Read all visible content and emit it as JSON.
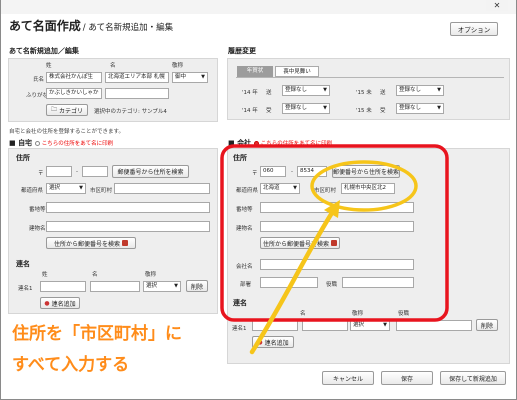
{
  "window": {
    "close_glyph": "✕"
  },
  "header": {
    "title": "あて名面作成",
    "subtitle": "/ あて名新規追加・編集",
    "option_label": "オプション"
  },
  "left": {
    "section_title": "あて名新規追加／編集",
    "col_sei": "姓",
    "col_mei": "名",
    "col_keisho": "敬称",
    "name_label": "氏名",
    "name_sei": "株式会社かんぽ生",
    "name_mei": "北海道エリア本部 札幌",
    "keisho": "御中",
    "furigana_label": "ふりがな",
    "furigana_value": "かぶしきかいしゃか",
    "category_button": "カテゴリ",
    "category_text": "選択中のカテゴリ: サンプル4"
  },
  "history": {
    "section_title": "履歴変更",
    "tab_sent": "年賀状",
    "tab_mourning": "喪中見舞い",
    "rows": [
      {
        "year": "'14 年",
        "type": "送",
        "value": "登録なし"
      },
      {
        "year": "'14 年",
        "type": "受",
        "value": "登録なし"
      },
      {
        "year": "'15 未",
        "type": "送",
        "value": "登録なし"
      },
      {
        "year": "'15 未",
        "type": "受",
        "value": "登録なし"
      }
    ]
  },
  "note": "自宅と会社の住所を登録することができます。",
  "home": {
    "title": "自宅",
    "radio_label": "こちらの住所をあて名に印刷",
    "address_title": "住所",
    "postal_mark": "〒",
    "postal_sep": "-",
    "zip_to_addr": "郵便番号から住所を検索",
    "pref_label": "都道府県",
    "pref_value": "選択",
    "city_label": "市区町村",
    "banchi_label": "番地等",
    "building_label": "建物名",
    "addr_to_zip": "住所から郵便番号を検索",
    "renmei_title": "連名",
    "renmei_sei": "姓",
    "renmei_mei": "名",
    "renmei_keisho": "敬称",
    "renmei1": "連名1",
    "keisho_value": "選択",
    "delete": "削除",
    "add_renmei": "連名追加"
  },
  "company": {
    "title": "会社",
    "radio_label": "こちらの住所をあて名に印刷",
    "address_title": "住所",
    "postal_mark": "〒",
    "zip1": "060",
    "postal_sep": "-",
    "zip2": "8534",
    "zip_to_addr": "郵便番号から住所を検索",
    "pref_label": "都道府県",
    "pref_value": "北海道",
    "city_label": "市区町村",
    "city_value": "札幌市中央区北2",
    "banchi_label": "番地等",
    "building_label": "建物名",
    "addr_to_zip": "住所から郵便番号を検索",
    "company_label": "会社名",
    "dept_label": "部署",
    "title_label": "役職",
    "renmei_title": "連名",
    "renmei_mei": "名",
    "renmei_keisho": "敬称",
    "renmei_yakushoku": "役職",
    "renmei1": "連名1",
    "keisho_value": "選択",
    "delete": "削除",
    "add_renmei": "連名追加"
  },
  "annotation": {
    "line1": "住所を「市区町村」に",
    "line2": "すべて入力する"
  },
  "footer": {
    "cancel": "キャンセル",
    "save": "保存",
    "save_new": "保存して新規追加"
  },
  "colors": {
    "highlight_red": "#e8141e",
    "annotation_yellow": "#f6c51a",
    "annotation_text": "#ff8c1a"
  }
}
